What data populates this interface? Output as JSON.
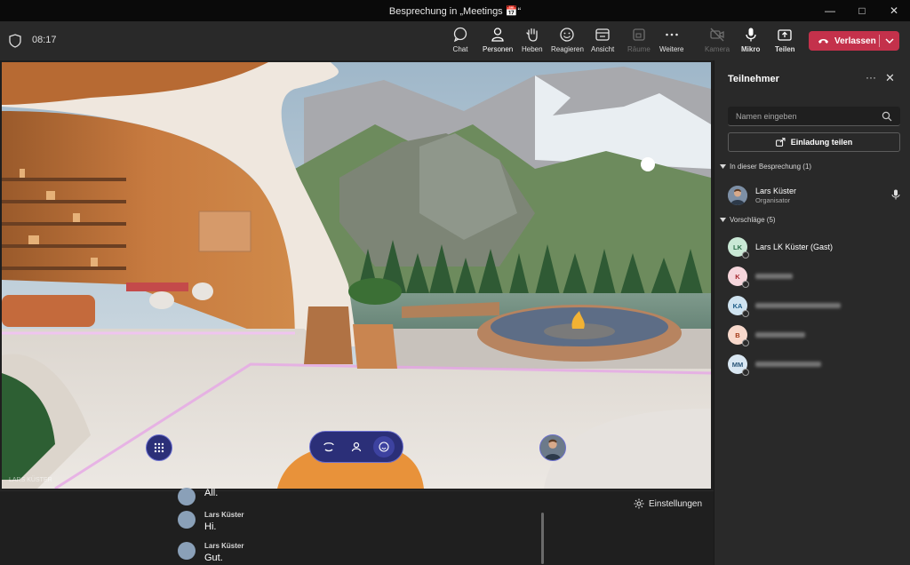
{
  "window": {
    "title": "Besprechung in „Meetings 📅“",
    "controls": [
      "minimize",
      "maximize",
      "close"
    ]
  },
  "toolbar": {
    "timer": "08:17",
    "buttons": [
      {
        "id": "chat",
        "label": "Chat",
        "icon": "chat-icon",
        "state": "normal"
      },
      {
        "id": "people",
        "label": "Personen",
        "icon": "people-icon",
        "state": "active"
      },
      {
        "id": "raise",
        "label": "Heben",
        "icon": "raise-hand-icon",
        "state": "normal"
      },
      {
        "id": "react",
        "label": "Reagieren",
        "icon": "emoji-icon",
        "state": "normal"
      },
      {
        "id": "view",
        "label": "Ansicht",
        "icon": "view-icon",
        "state": "normal"
      },
      {
        "id": "rooms",
        "label": "Räume",
        "icon": "rooms-icon",
        "state": "disabled"
      },
      {
        "id": "more",
        "label": "Weitere",
        "icon": "more-icon",
        "state": "normal"
      },
      {
        "id": "camera",
        "label": "Kamera",
        "icon": "camera-off-icon",
        "state": "disabled"
      },
      {
        "id": "mic",
        "label": "Mikro",
        "icon": "microphone-icon",
        "state": "bold"
      },
      {
        "id": "share",
        "label": "Teilen",
        "icon": "share-screen-icon",
        "state": "normal"
      }
    ],
    "leave_label": "Verlassen",
    "leave_color": "#c4314b"
  },
  "stage": {
    "corner_label": "LARS KÜSTER",
    "controls": {
      "grid_icon": "grid-icon",
      "pill": [
        "teleport-icon",
        "avatar-icon",
        "emoji-icon"
      ]
    }
  },
  "chat": {
    "messages": [
      {
        "name": "",
        "text": "All."
      },
      {
        "name": "Lars Küster",
        "text": "Hi."
      },
      {
        "name": "Lars Küster",
        "text": "Gut."
      }
    ],
    "settings_label": "Einstellungen"
  },
  "panel": {
    "title": "Teilnehmer",
    "search_placeholder": "Namen eingeben",
    "share_invite": "Einladung teilen",
    "in_meeting_header": "In dieser Besprechung (1)",
    "in_meeting": [
      {
        "name": "Lars Küster",
        "role": "Organisator"
      }
    ],
    "suggestions_header": "Vorschläge (5)",
    "suggestions": [
      {
        "initials": "LK",
        "name": "Lars LK Küster (Gast)",
        "color": "#c9e8d5",
        "text_color": "#2c6e49"
      },
      {
        "initials": "K",
        "name": "",
        "color": "#f6d6dc",
        "text_color": "#a4262c"
      },
      {
        "initials": "KA",
        "name": "",
        "color": "#cfe3f0",
        "text_color": "#1b5a86"
      },
      {
        "initials": "B",
        "name": "",
        "color": "#f8d9cc",
        "text_color": "#a33a17"
      },
      {
        "initials": "MM",
        "name": "",
        "color": "#d9e7f2",
        "text_color": "#2a5578"
      }
    ]
  }
}
